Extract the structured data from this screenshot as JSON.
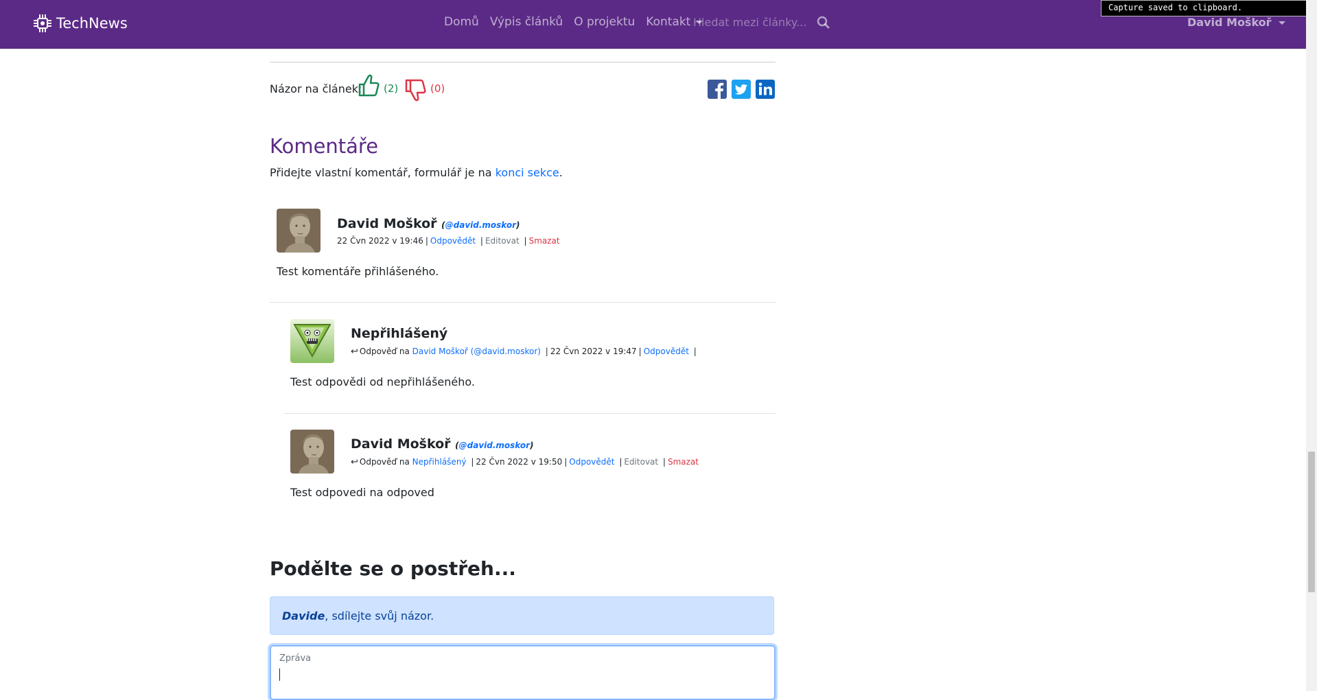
{
  "navbar": {
    "brand": "TechNews",
    "links": [
      "Domů",
      "Výpis článků",
      "O projektu"
    ],
    "dropdown_label": "Kontakt",
    "search_placeholder": "Hledat mezi články...",
    "user_label": "David Moškoř"
  },
  "toast": "Capture saved to clipboard.",
  "article": {
    "opinion_label": "Názor na článek:",
    "likes": "(2)",
    "dislikes": "(0)"
  },
  "share_icons": [
    "facebook-icon",
    "twitter-icon",
    "linkedin-icon"
  ],
  "comments": {
    "title": "Komentáře",
    "intro_text": "Přidejte vlastní komentář, formulář je na",
    "intro_link": "konci sekce",
    "intro_end": ".",
    "items": [
      {
        "author": "David Moškoř",
        "handle": "(@david.moskor)",
        "date": "22 Čvn 2022 v 19:46",
        "reply": "Odpovědět",
        "edit": "Editovat",
        "delete": "Smazat",
        "text": "Test komentáře přihlášeného."
      },
      {
        "author": "Nepřihlášený",
        "reply_to_label": "Odpověď na",
        "reply_to": "David Moškoř (@david.moskor)",
        "date": "22 Čvn 2022 v 19:47",
        "reply": "Odpovědět",
        "text": "Test odpovědi od nepřihlášeného."
      },
      {
        "author": "David Moškoř",
        "handle": "(@david.moskor)",
        "reply_to_label": "Odpověď na",
        "reply_to": "Nepřihlášený",
        "date": "22 Čvn 2022 v 19:50",
        "reply": "Odpovědět",
        "edit": "Editovat",
        "delete": "Smazat",
        "text": "Test odpovedi na odpoved"
      }
    ]
  },
  "form": {
    "heading": "Podělte se o postřeh...",
    "alert_name": "Davide",
    "alert_text": ", sdílejte svůj názor.",
    "textarea_label": "Zpráva"
  },
  "colors": {
    "navbar": "#5b2a86",
    "accent": "#5b2a86",
    "like": "#198754",
    "dislike": "#dc3545",
    "link": "#0d6efd"
  }
}
